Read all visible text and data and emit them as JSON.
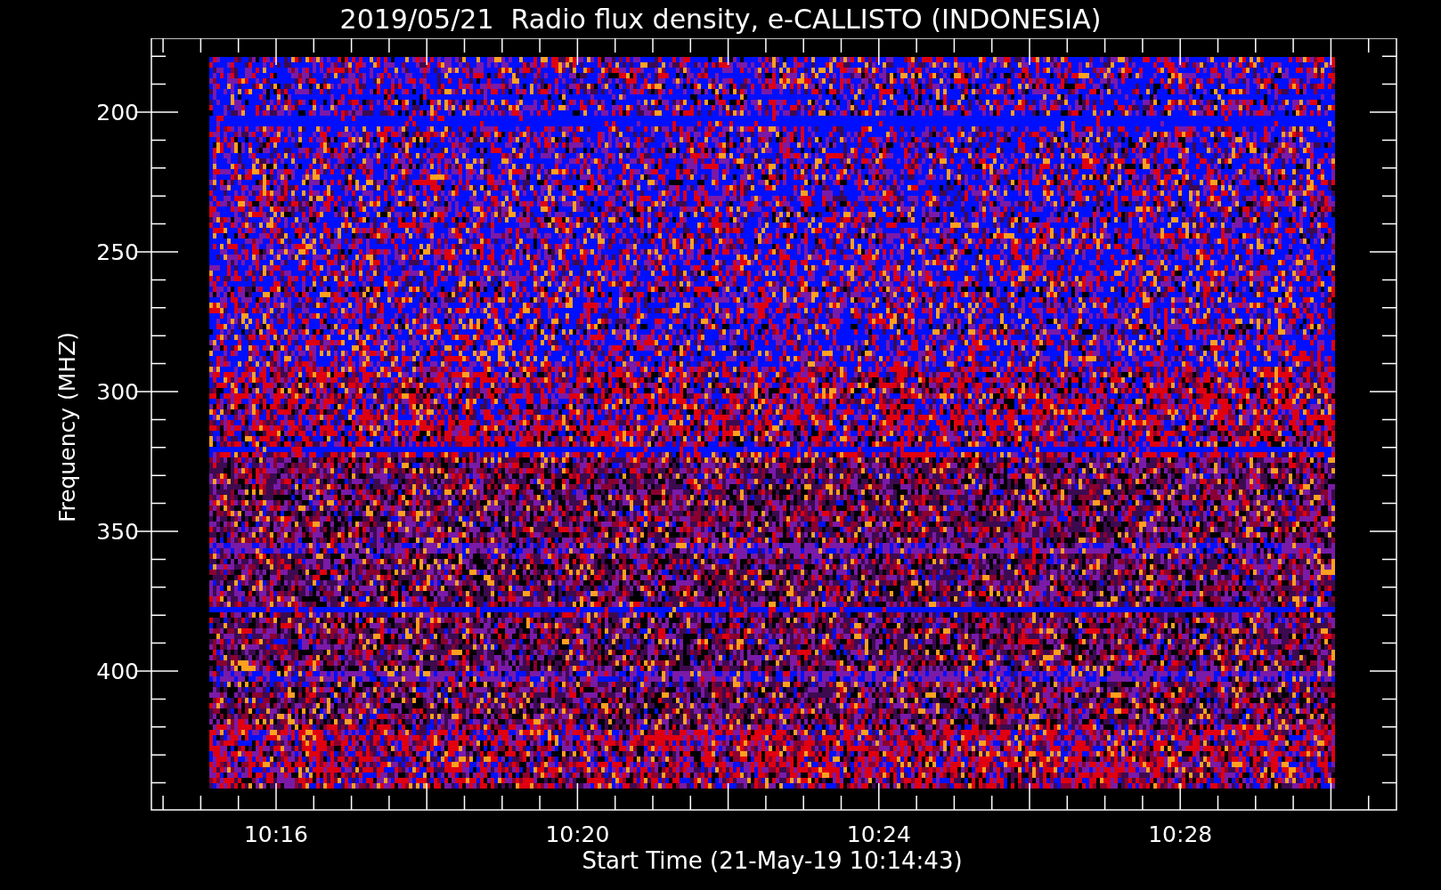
{
  "plot": {
    "title": "2019/05/21  Radio flux density, e-CALLISTO (INDONESIA)",
    "ylabel": "Frequency (MHZ)",
    "xlabel": "Start Time (21-May-19 10:14:43)",
    "yticks": [
      "200",
      "250",
      "300",
      "350",
      "400"
    ],
    "xticks": [
      "10:16",
      "10:20",
      "10:24",
      "10:28"
    ]
  }
}
